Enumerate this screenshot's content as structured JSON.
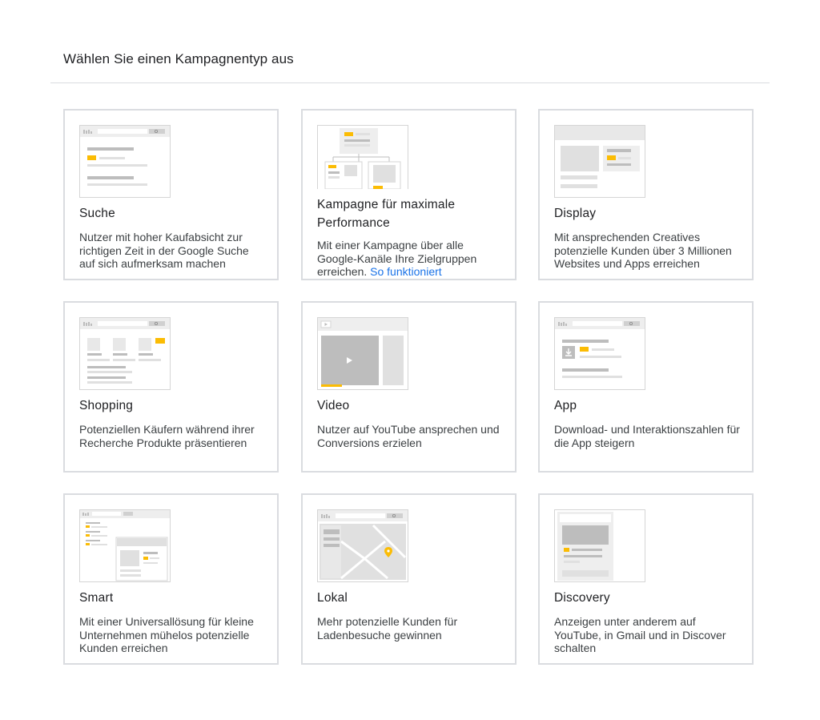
{
  "page": {
    "title": "Wählen Sie einen Kampagnentyp aus"
  },
  "cards": [
    {
      "name": "Suche",
      "description": "Nutzer mit hoher Kaufabsicht zur richtigen Zeit in der Google Suche auf sich aufmerksam machen",
      "icon": "search-ad-illustration"
    },
    {
      "name": "Kampagne für maximale Performance",
      "description": "Mit einer Kampagne über alle Google-Kanäle Ihre Zielgruppen erreichen.",
      "link": "So funktioniert",
      "icon": "performance-max-illustration"
    },
    {
      "name": "Display",
      "description": "Mit ansprechenden Creatives potenzielle Kunden über 3 Millionen Websites und Apps erreichen",
      "icon": "display-ad-illustration"
    },
    {
      "name": "Shopping",
      "description": "Potenziellen Käufern während ihrer Recherche Produkte präsentieren",
      "icon": "shopping-ad-illustration"
    },
    {
      "name": "Video",
      "description": "Nutzer auf YouTube ansprechen und Conversions erzielen",
      "icon": "video-ad-illustration"
    },
    {
      "name": "App",
      "description": "Download- und Interaktionszahlen für die App steigern",
      "icon": "app-ad-illustration"
    },
    {
      "name": "Smart",
      "description": "Mit einer Universallösung für kleine Unternehmen mühelos potenzielle Kunden erreichen",
      "icon": "smart-ad-illustration"
    },
    {
      "name": "Lokal",
      "description": "Mehr potenzielle Kunden für Ladenbesuche gewinnen",
      "icon": "local-map-illustration"
    },
    {
      "name": "Discovery",
      "description": "Anzeigen unter anderem auf YouTube, in Gmail und in Discover schalten",
      "icon": "discovery-feed-illustration"
    }
  ],
  "colors": {
    "accent": "#fbbc04",
    "border": "#dadce0",
    "placeholder_dark": "#bdbdbd",
    "placeholder_light": "#e0e0e0",
    "link": "#1a73e8"
  }
}
